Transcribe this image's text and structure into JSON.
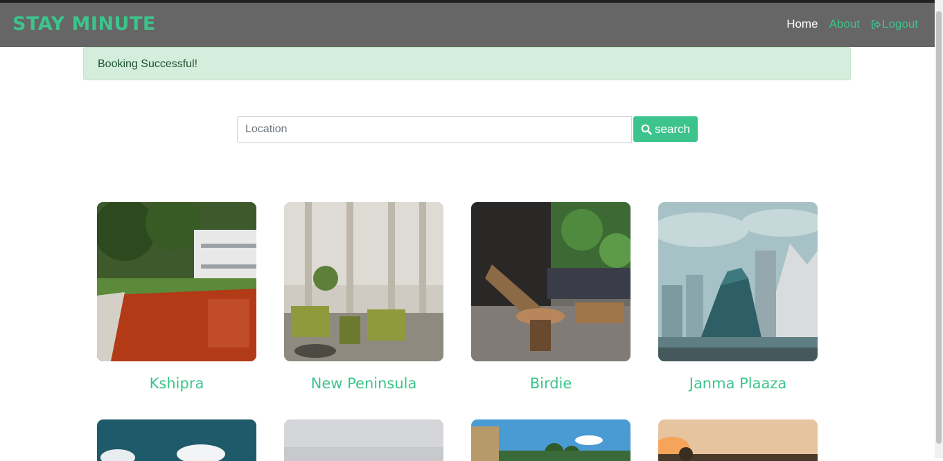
{
  "navbar": {
    "brand": "STAY MINUTE",
    "links": [
      {
        "label": "Home",
        "active": true
      },
      {
        "label": "About",
        "active": false
      },
      {
        "label": "Logout",
        "active": false,
        "icon": "logout-icon"
      }
    ]
  },
  "alert": {
    "message": "Booking Successful!"
  },
  "search": {
    "placeholder": "Location",
    "value": "",
    "button_label": "search",
    "icon": "search-icon"
  },
  "hotels": [
    {
      "name": "Kshipra"
    },
    {
      "name": "New Peninsula"
    },
    {
      "name": "Birdie"
    },
    {
      "name": "Janma Plaaza"
    }
  ],
  "colors": {
    "accent": "#3cc48c",
    "navbar": "#666666",
    "alert_bg": "#d4eddc"
  }
}
